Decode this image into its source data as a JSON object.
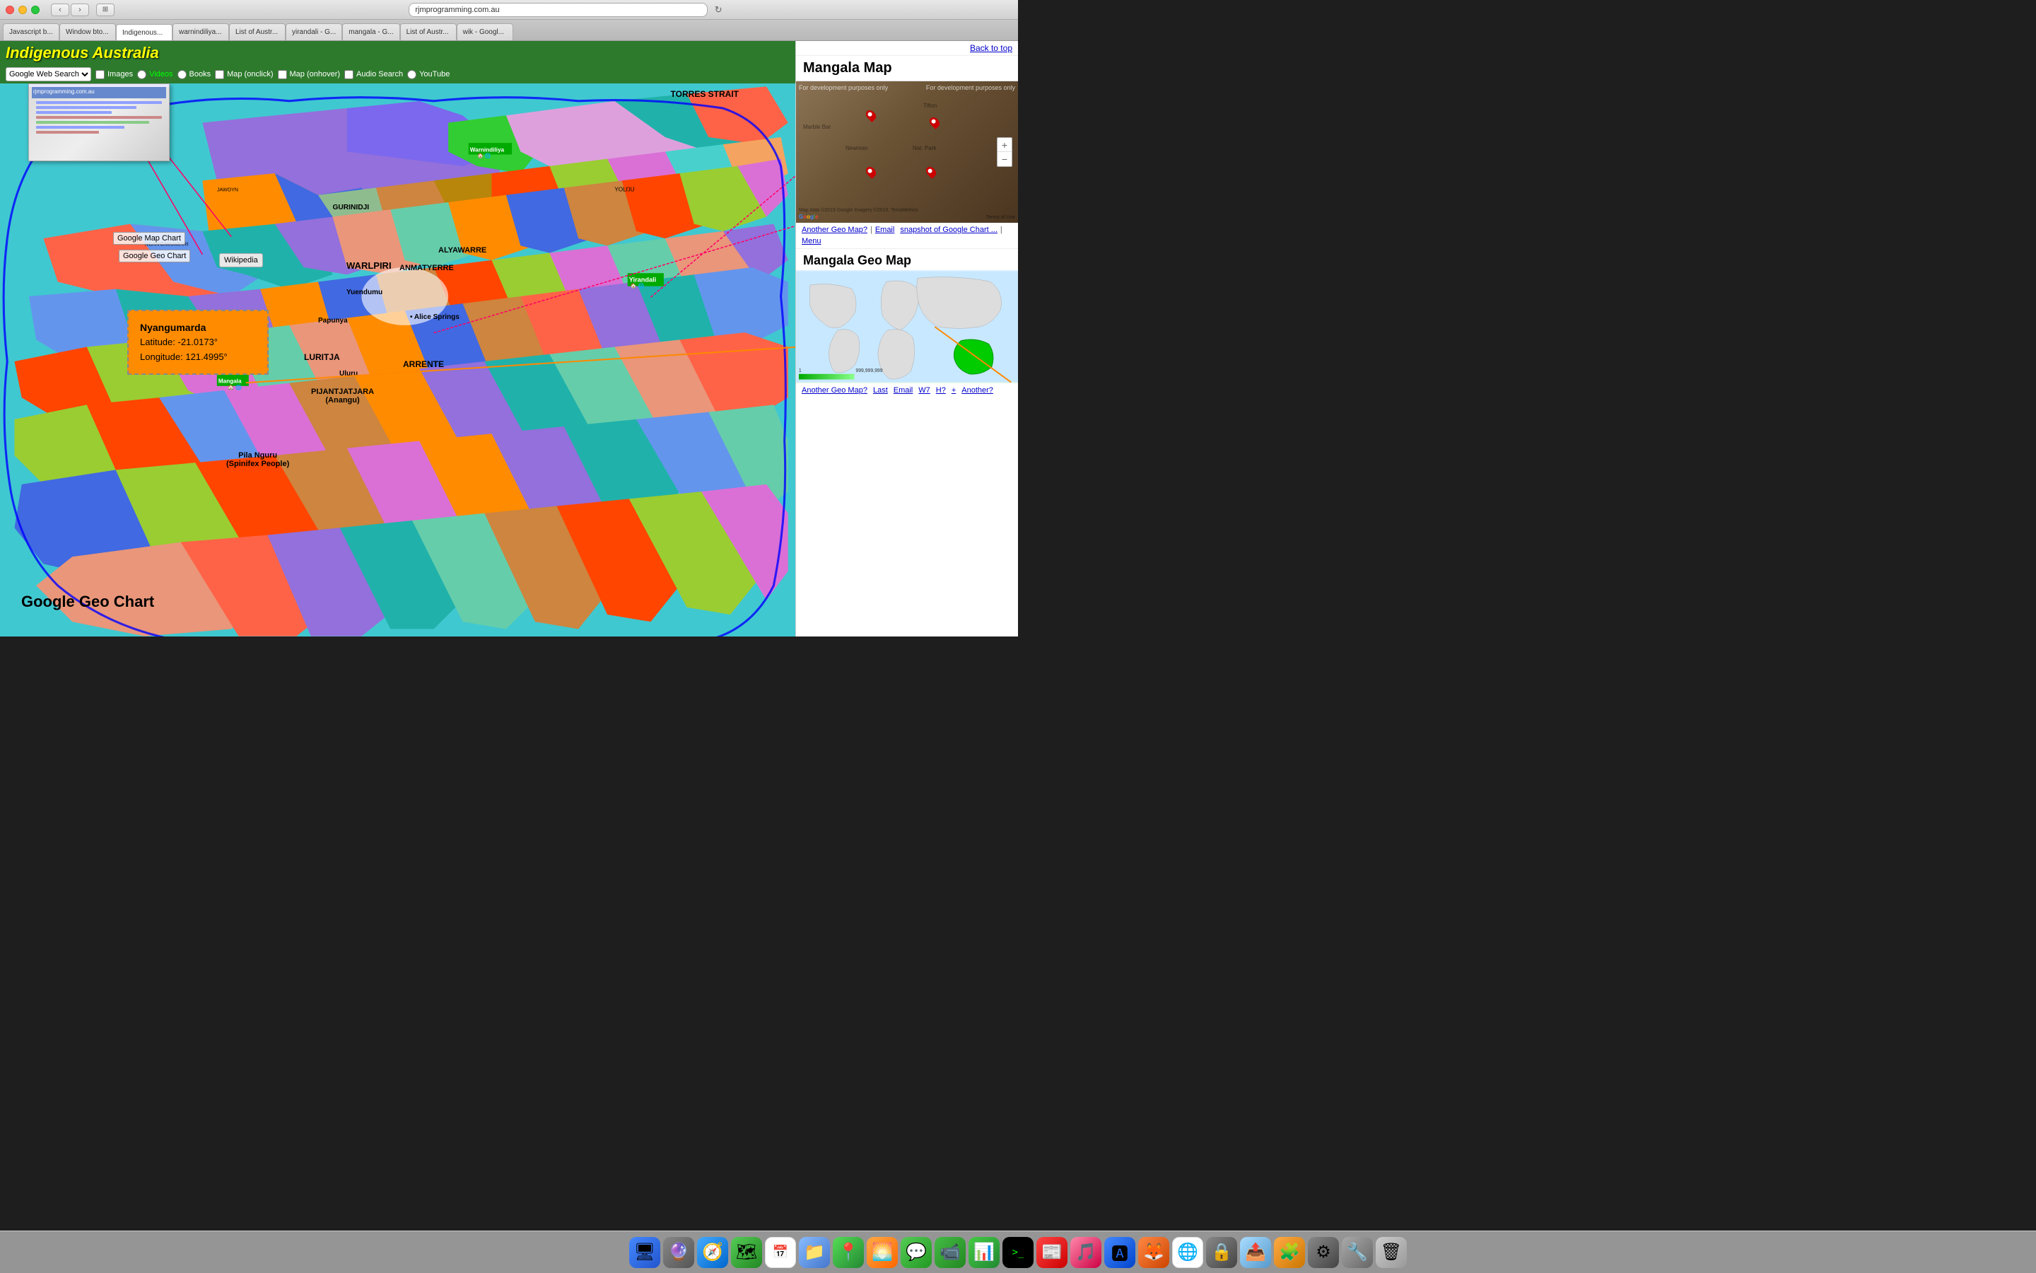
{
  "titlebar": {
    "url": "rjmprogramming.com.au"
  },
  "tabs": [
    {
      "label": "Javascript b...",
      "active": false
    },
    {
      "label": "Window bto...",
      "active": false
    },
    {
      "label": "Indigenous...",
      "active": true
    },
    {
      "label": "warnindiliya...",
      "active": false
    },
    {
      "label": "List of Austr...",
      "active": false
    },
    {
      "label": "yirandali - G...",
      "active": false
    },
    {
      "label": "mangala - G...",
      "active": false
    },
    {
      "label": "List of Austr...",
      "active": false
    },
    {
      "label": "wik - Googl...",
      "active": false
    }
  ],
  "header": {
    "title": "Indigenous Australia",
    "search_type": "Google Web Search"
  },
  "search_options": [
    "Images",
    "Videos",
    "Books",
    "Map (onclick)",
    "Map (onhover)",
    "Audio Search",
    "YouTube"
  ],
  "map": {
    "torres_strait": "TORRES STRAIT",
    "warlpiri": "WARLPIRI",
    "luritja": "LURITJA",
    "arrente": "ARRENTE",
    "anmatyerre": "ANMATYERRE",
    "alyawarre": "ALYAWARRE",
    "yuendumu": "Yuendumu",
    "papunya": "Papunya",
    "alice_springs": "• Alice Springs",
    "uluru": "Uluru",
    "pijantjatjara": "PIJANTJATJARA\n(Anangu)",
    "pila_nguru": "Pila Nguru\n(Spinifex People)"
  },
  "tooltip": {
    "name": "Nyangumarda",
    "latitude": "Latitude: -21.0173°",
    "longitude": "Longitude: 121.4995°"
  },
  "floating_labels": {
    "google_map_chart": "Google Map Chart",
    "google_geo_chart": "Google Geo Chart",
    "wikipedia": "Wikipedia"
  },
  "location_markers": {
    "yirandali": "Yirandali",
    "mangala": "Mangala"
  },
  "right_panel": {
    "title": "Mangala Map",
    "dev_purposes": "For development purposes only",
    "back_to_top": "Back to top",
    "links": {
      "another_geo": "Another Geo Map?",
      "email": "Email",
      "snapshot": "snapshot of Google Chart ...",
      "menu": "Menu"
    },
    "geo_title": "Mangala Geo Map",
    "geo_links": {
      "another": "Another Geo Map?",
      "last": "Last",
      "email": "Email",
      "w7": "W7",
      "h7": "H?",
      "plus": "+",
      "another2": "Another?"
    },
    "bar_range": "1 ————————————————————— 999,999,999"
  }
}
